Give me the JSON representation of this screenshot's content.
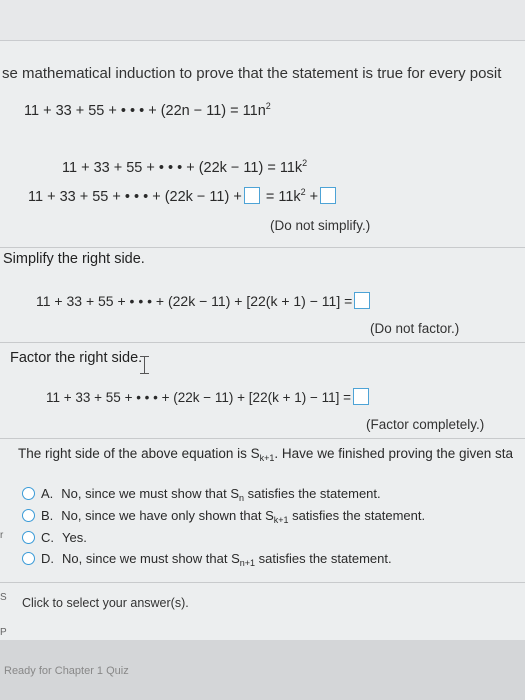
{
  "instruction": "se mathematical induction to prove that the statement is true for every posit",
  "statement": {
    "lhs": "11 + 33 + 55 + • • • + (22n − 11) = 11n",
    "exp": "2"
  },
  "step_assume": {
    "lhs": "11 + 33 + 55 + • • • + (22k − 11)  =  11k",
    "exp": "2"
  },
  "step_add": {
    "lhs": "11 + 33 + 55 + • • • + (22k − 11) +",
    "eq": " = 11k",
    "exp": "2",
    "plus": " +",
    "note": "(Do not simplify.)"
  },
  "simplify": {
    "title": "Simplify the right side.",
    "lhs": "11 + 33 + 55 + • • • + (22k − 11) + [22(k + 1) − 11]  =",
    "note": "(Do not factor.)"
  },
  "factor": {
    "title": "Factor the right side.",
    "lhs": "11 + 33 + 55 + • • • + (22k − 11) + [22(k + 1) − 11]  =",
    "note": "(Factor completely.)"
  },
  "question": {
    "pre": "The right side of the above equation is S",
    "sub": "k+1",
    "post": ". Have we finished proving the given sta"
  },
  "options": [
    {
      "letter": "A.",
      "pre": "No, since we must show that S",
      "sub": "n",
      "post": " satisfies the statement."
    },
    {
      "letter": "B.",
      "pre": "No, since we have only shown that S",
      "sub": "k+1",
      "post": " satisfies the statement."
    },
    {
      "letter": "C.",
      "pre": "Yes.",
      "sub": "",
      "post": ""
    },
    {
      "letter": "D.",
      "pre": "No, since we must show that S",
      "sub": "n+1",
      "post": " satisfies the statement."
    }
  ],
  "click_prompt": "Click to select your answer(s).",
  "status_text": "Ready for Chapter 1 Quiz",
  "side_marks": [
    "r",
    "S",
    "P"
  ]
}
